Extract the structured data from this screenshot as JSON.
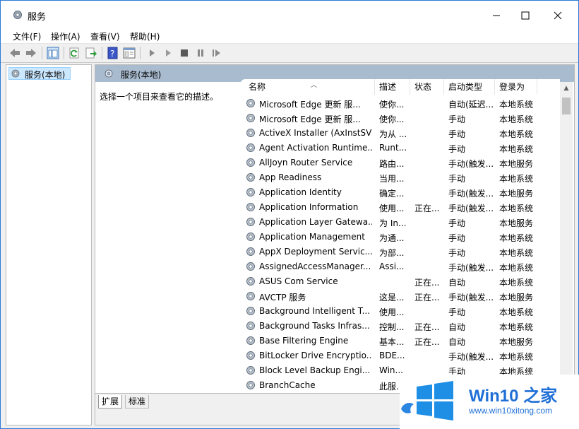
{
  "window": {
    "title": "服务"
  },
  "menu": [
    "文件(F)",
    "操作(A)",
    "查看(V)",
    "帮助(H)"
  ],
  "tree": {
    "root_label": "服务(本地)"
  },
  "right_pane": {
    "header": "服务(本地)",
    "description_hint": "选择一个项目来查看它的描述。"
  },
  "columns": [
    "名称",
    "描述",
    "状态",
    "启动类型",
    "登录为"
  ],
  "services": [
    {
      "name": "Microsoft Edge 更新 服...",
      "desc": "使你...",
      "status": "",
      "startup": "自动(延迟...",
      "logon": "本地系统"
    },
    {
      "name": "Microsoft Edge 更新 服...",
      "desc": "使你...",
      "status": "",
      "startup": "手动",
      "logon": "本地系统"
    },
    {
      "name": "ActiveX Installer (AxInstSV)",
      "desc": "为从 ...",
      "status": "",
      "startup": "手动",
      "logon": "本地系统"
    },
    {
      "name": "Agent Activation Runtime...",
      "desc": "Runt...",
      "status": "",
      "startup": "手动",
      "logon": "本地系统"
    },
    {
      "name": "AllJoyn Router Service",
      "desc": "路由...",
      "status": "",
      "startup": "手动(触发...",
      "logon": "本地服务"
    },
    {
      "name": "App Readiness",
      "desc": "当用...",
      "status": "",
      "startup": "手动",
      "logon": "本地系统"
    },
    {
      "name": "Application Identity",
      "desc": "确定...",
      "status": "",
      "startup": "手动(触发...",
      "logon": "本地服务"
    },
    {
      "name": "Application Information",
      "desc": "使用...",
      "status": "正在...",
      "startup": "手动(触发...",
      "logon": "本地系统"
    },
    {
      "name": "Application Layer Gatewa...",
      "desc": "为 In...",
      "status": "",
      "startup": "手动",
      "logon": "本地服务"
    },
    {
      "name": "Application Management",
      "desc": "为通...",
      "status": "",
      "startup": "手动",
      "logon": "本地系统"
    },
    {
      "name": "AppX Deployment Servic...",
      "desc": "为部...",
      "status": "",
      "startup": "手动",
      "logon": "本地系统"
    },
    {
      "name": "AssignedAccessManager...",
      "desc": "Assi...",
      "status": "",
      "startup": "手动(触发...",
      "logon": "本地系统"
    },
    {
      "name": "ASUS Com Service",
      "desc": "",
      "status": "正在...",
      "startup": "自动",
      "logon": "本地系统"
    },
    {
      "name": "AVCTP 服务",
      "desc": "这是...",
      "status": "正在...",
      "startup": "手动(触发...",
      "logon": "本地服务"
    },
    {
      "name": "Background Intelligent T...",
      "desc": "使用...",
      "status": "",
      "startup": "手动",
      "logon": "本地系统"
    },
    {
      "name": "Background Tasks Infras...",
      "desc": "控制...",
      "status": "正在...",
      "startup": "自动",
      "logon": "本地系统"
    },
    {
      "name": "Base Filtering Engine",
      "desc": "基本...",
      "status": "正在...",
      "startup": "自动",
      "logon": "本地服务"
    },
    {
      "name": "BitLocker Drive Encryptio...",
      "desc": "BDE...",
      "status": "",
      "startup": "手动(触发...",
      "logon": "本地系统"
    },
    {
      "name": "Block Level Backup Engi...",
      "desc": "Win...",
      "status": "",
      "startup": "手动",
      "logon": "本地系统"
    },
    {
      "name": "BranchCache",
      "desc": "此服...",
      "status": "",
      "startup": "",
      "logon": ""
    }
  ],
  "tabs": [
    "扩展",
    "标准"
  ],
  "watermark": {
    "title": "Win10 之家",
    "url": "www.win10xitong.com"
  },
  "colors": {
    "accent": "#2b79d6",
    "header_bar": "#a9bbcf",
    "selection": "#cce8ff",
    "watermark_blue": "#1f6fd6"
  }
}
